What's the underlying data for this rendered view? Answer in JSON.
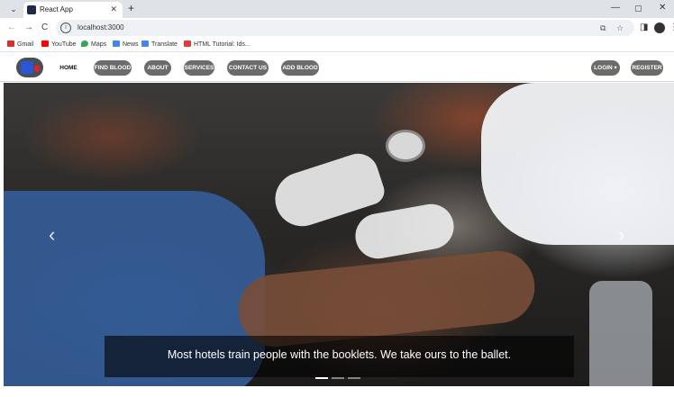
{
  "browser": {
    "tab": {
      "title": "React App",
      "close": "✕"
    },
    "new_tab": "+",
    "window": {
      "minimize": "—",
      "maximize": "▢",
      "close": "✕"
    },
    "nav": {
      "back": "←",
      "forward": "→",
      "reload": "C"
    },
    "address": {
      "url": "localhost:3000",
      "site_info": "i"
    },
    "toolbar_icons": {
      "install": "⧉",
      "star": "☆",
      "side_panel": "◨",
      "menu": "⋮"
    },
    "bookmarks": [
      {
        "label": "Gmail",
        "color": "#d93025"
      },
      {
        "label": "YouTube",
        "color": "#ff0000"
      },
      {
        "label": "Maps",
        "color": "#34a853"
      },
      {
        "label": "News",
        "color": "#4285f4"
      },
      {
        "label": "Translate",
        "color": "#4285f4"
      },
      {
        "label": "HTML Tutorial: Ids...",
        "color": "#e53935"
      }
    ]
  },
  "app": {
    "nav": {
      "items": [
        "HOME",
        "FIND BLOOD",
        "ABOUT",
        "SERVICES",
        "CONTACT US",
        "ADD BLOOD"
      ],
      "login": "LOGIN ▾",
      "register": "REGISTER"
    },
    "carousel": {
      "prev": "‹",
      "next": "›",
      "caption": "Most hotels train people with the booklets. We take ours to the ballet.",
      "slide_count": 3,
      "active_index": 0
    }
  },
  "colors": {
    "pill_bg": "#6b6b6b",
    "pill_text": "#ffffff",
    "logo_bg": "#4a4f57",
    "logo_blue": "#2a56d6",
    "logo_red": "#e02424"
  }
}
